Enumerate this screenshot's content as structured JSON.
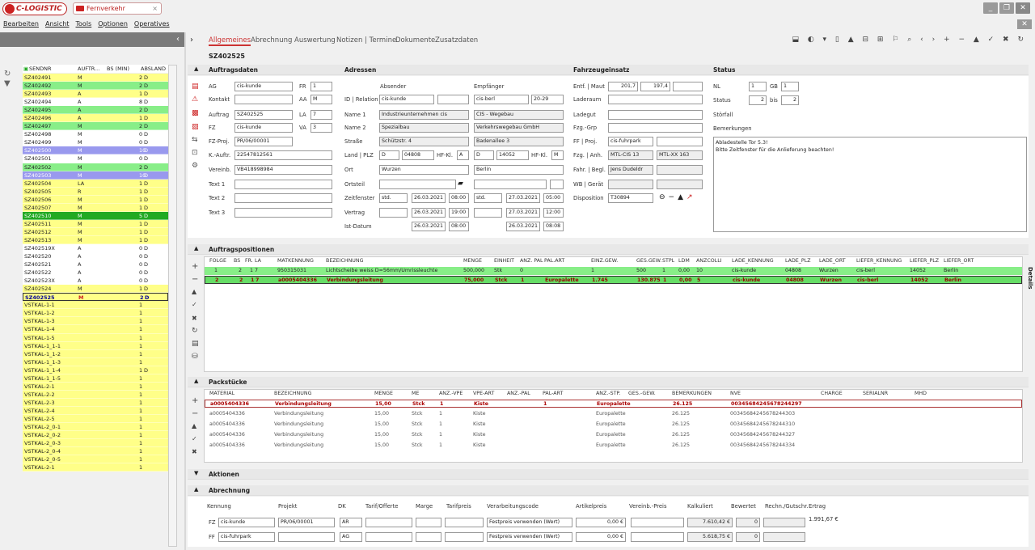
{
  "app": {
    "logo": "C-LOGISTIC",
    "tab": "Fernverkehr"
  },
  "menu": [
    "Bearbeiten",
    "Ansicht",
    "Tools",
    "Optionen",
    "Operatives"
  ],
  "list": {
    "headers": [
      "SENDNR",
      "AUFTR...",
      "BS (MIN)",
      "ABSLAND"
    ],
    "rows": [
      [
        "SZ402491",
        "M",
        "2",
        "D",
        "#ffff88"
      ],
      [
        "SZ402492",
        "M",
        "2",
        "D",
        "#88ee88"
      ],
      [
        "SZ402493",
        "A",
        "1",
        "D",
        "#ffff88"
      ],
      [
        "SZ402494",
        "A",
        "8",
        "D",
        "#ffffff"
      ],
      [
        "SZ402495",
        "A",
        "2",
        "D",
        "#88ee88"
      ],
      [
        "SZ402496",
        "A",
        "1",
        "D",
        "#ffff88"
      ],
      [
        "SZ402497",
        "M",
        "2",
        "D",
        "#88ee88"
      ],
      [
        "SZ402498",
        "M",
        "0",
        "D",
        "#ffffff"
      ],
      [
        "SZ402499",
        "M",
        "0",
        "D",
        "#ffffff"
      ],
      [
        "SZ402500",
        "M",
        "10",
        "D",
        "#9999ee"
      ],
      [
        "SZ402501",
        "M",
        "0",
        "D",
        "#ffffff"
      ],
      [
        "SZ402502",
        "M",
        "2",
        "D",
        "#88ee88"
      ],
      [
        "SZ402503",
        "M",
        "10",
        "D",
        "#9999ee"
      ],
      [
        "SZ402504",
        "LA",
        "1",
        "D",
        "#ffff88"
      ],
      [
        "SZ402505",
        "R",
        "1",
        "D",
        "#ffff88"
      ],
      [
        "SZ402506",
        "M",
        "1",
        "D",
        "#ffff88"
      ],
      [
        "SZ402507",
        "M",
        "1",
        "D",
        "#ffff88"
      ],
      [
        "SZ402510",
        "M",
        "5",
        "D",
        "#22aa22"
      ],
      [
        "SZ402511",
        "M",
        "1",
        "D",
        "#ffff88"
      ],
      [
        "SZ402512",
        "M",
        "1",
        "D",
        "#ffff88"
      ],
      [
        "SZ402513",
        "M",
        "1",
        "D",
        "#ffff88"
      ],
      [
        "SZ402519X",
        "A",
        "0",
        "D",
        "#ffffff"
      ],
      [
        "SZ402520",
        "A",
        "0",
        "D",
        "#ffffff"
      ],
      [
        "SZ402521",
        "A",
        "0",
        "D",
        "#ffffff"
      ],
      [
        "SZ402522",
        "A",
        "0",
        "D",
        "#ffffff"
      ],
      [
        "SZ402523X",
        "A",
        "0",
        "D",
        "#ffffff"
      ],
      [
        "SZ402524",
        "M",
        "1",
        "D",
        "#ffff88"
      ],
      [
        "SZ402525",
        "M",
        "2",
        "D",
        "#ffff88"
      ],
      [
        "VSTKAL-1-1",
        "",
        "1",
        "",
        "#ffff88"
      ],
      [
        "VSTKAL-1-2",
        "",
        "1",
        "",
        "#ffff88"
      ],
      [
        "VSTKAL-1-3",
        "",
        "1",
        "",
        "#ffff88"
      ],
      [
        "VSTKAL-1-4",
        "",
        "1",
        "",
        "#ffff88"
      ],
      [
        "VSTKAL-1-5",
        "",
        "1",
        "",
        "#ffff88"
      ],
      [
        "VSTKAL-1_1-1",
        "",
        "1",
        "",
        "#ffff88"
      ],
      [
        "VSTKAL-1_1-2",
        "",
        "1",
        "",
        "#ffff88"
      ],
      [
        "VSTKAL-1_1-3",
        "",
        "1",
        "",
        "#ffff88"
      ],
      [
        "VSTKAL-1_1-4",
        "",
        "1",
        "D",
        "#ffff88"
      ],
      [
        "VSTKAL-1_1-5",
        "",
        "1",
        "",
        "#ffff88"
      ],
      [
        "VSTKAL-2-1",
        "",
        "1",
        "",
        "#ffff88"
      ],
      [
        "VSTKAL-2-2",
        "",
        "1",
        "",
        "#ffff88"
      ],
      [
        "VSTKAL-2-3",
        "",
        "1",
        "",
        "#ffff88"
      ],
      [
        "VSTKAL-2-4",
        "",
        "1",
        "",
        "#ffff88"
      ],
      [
        "VSTKAL-2-5",
        "",
        "1",
        "",
        "#ffff88"
      ],
      [
        "VSTKAL-2_0-1",
        "",
        "1",
        "",
        "#ffff88"
      ],
      [
        "VSTKAL-2_0-2",
        "",
        "1",
        "",
        "#ffff88"
      ],
      [
        "VSTKAL-2_0-3",
        "",
        "1",
        "",
        "#ffff88"
      ],
      [
        "VSTKAL-2_0-4",
        "",
        "1",
        "",
        "#ffff88"
      ],
      [
        "VSTKAL-2_0-5",
        "",
        "1",
        "",
        "#ffff88"
      ],
      [
        "VSTKAL-2-1",
        "",
        "1",
        "",
        "#ffff88"
      ]
    ]
  },
  "tabs": [
    "Allgemeines",
    "Abrechnung",
    "Auswertung",
    "Notizen | Termine",
    "Dokumente",
    "Zusatzdaten"
  ],
  "sendnr": "SZ402525",
  "sections": {
    "auftragsdaten": "Auftragsdaten",
    "adressen": "Adressen",
    "fahrzeug": "Fahrzeugeinsatz",
    "status": "Status",
    "positionen": "Auftragspositionen",
    "pack": "Packstücke",
    "aktionen": "Aktionen",
    "abrechnung": "Abrechnung"
  },
  "auftrag": {
    "ag_label": "AG",
    "ag": "cis-kunde",
    "fr_label": "FR",
    "fr": "1",
    "kontakt_label": "Kontakt",
    "aa_label": "AA",
    "aa": "M",
    "auftrag_label": "Auftrag",
    "auftrag": "SZ402525",
    "la_label": "LA",
    "la": "7",
    "fz_label": "FZ",
    "fz": "cis-kunde",
    "va_label": "VA",
    "va": "3",
    "fzproj_label": "FZ-Proj.",
    "fzproj": "PR/06/00001",
    "kauftr_label": "K.-Auftr.",
    "kauftr": "22547812561",
    "vereinb_label": "Vereinb.",
    "vereinb": "VB418998984",
    "text1_label": "Text 1",
    "text2_label": "Text 2",
    "text3_label": "Text 3"
  },
  "adressen": {
    "absender_label": "Absender",
    "empf_label": "Empfänger",
    "id_label": "ID | Relation",
    "abs_id": "cis-kunde",
    "emp_id": "cis-berl",
    "emp_rel": "20-29",
    "name1_label": "Name 1",
    "abs_name1": "Industrieunternehmen cis",
    "emp_name1": "CIS - Wegebau",
    "name2_label": "Name 2",
    "abs_name2": "Spezialbau",
    "emp_name2": "Verkehrswegebau GmbH",
    "strasse_label": "Straße",
    "abs_str": "Schützstr. 4",
    "emp_str": "Badenallee 3",
    "land_label": "Land | PLZ",
    "abs_land": "D",
    "abs_plz": "04808",
    "hfkl_label": "HF-Kl.",
    "abs_hfkl": "A",
    "emp_land": "D",
    "emp_plz": "14052",
    "emp_hfkl": "M",
    "ort_label": "Ort",
    "abs_ort": "Wurzen",
    "emp_ort": "Berlin",
    "ortsteil_label": "Ortsteil",
    "zeitfenster_label": "Zeitfenster",
    "abs_zf": "std.",
    "abs_zf_date": "26.03.2021",
    "abs_zf_time": "08:00",
    "emp_zf": "std.",
    "emp_zf_date": "27.03.2021",
    "emp_zf_time": "05:00",
    "vertrag_label": "Vertrag",
    "abs_v_date": "26.03.2021",
    "abs_v_time": "19:00",
    "emp_v_date": "27.03.2021",
    "emp_v_time": "12:00",
    "ist_label": "Ist-Datum",
    "abs_ist_date": "26.03.2021",
    "abs_ist_time": "08:00",
    "emp_ist_date": "26.03.2021",
    "emp_ist_time": "08:08"
  },
  "fahrzeug": {
    "entf_label": "Entf. | Maut",
    "entf": "201,7",
    "maut": "197,4",
    "laderaum_label": "Laderaum",
    "ladegut_label": "Ladegut",
    "fzggrp_label": "Fzg.-Grp",
    "ffproj_label": "FF | Proj.",
    "ff": "cis-fuhrpark",
    "anh_label": "Fzg. | Anh.",
    "fzg": "MTL-CIS 13",
    "anh": "MTL-XX 163",
    "fahr_label": "Fahr. | Begl.",
    "fahrer": "Jens Dudeldr",
    "wb_label": "WB | Gerät",
    "dispo_label": "Disposition",
    "dispo": "T30894"
  },
  "status": {
    "nl_label": "NL",
    "nl": "1",
    "gb_label": "GB",
    "gb": "1",
    "status_label": "Status",
    "status_from": "2",
    "bis_label": "bis",
    "status_to": "2",
    "stoerfall_label": "Störfall",
    "bem_label": "Bemerkungen",
    "bem_line1": "Abladestelle Tor 5.3!",
    "bem_line2": "Bitte Zeitfenster für die Anlieferung beachten!"
  },
  "positionen": {
    "headers": [
      "FOLGE",
      "BS",
      "FR.",
      "LA",
      "MATKENNUNG",
      "BEZEICHNUNG",
      "MENGE",
      "EINHEIT",
      "ANZ. PAL",
      "PAL.ART",
      "EINZ.GEW.",
      "GES.GEW.",
      "STPL",
      "LDM",
      "ANZCOLLI",
      "LADE_KENNUNG",
      "LADE_PLZ",
      "LADE_ORT",
      "LIEFER_KENNUNG",
      "LIEFER_PLZ",
      "LIEFER_ORT"
    ],
    "rows": [
      [
        "1",
        "2",
        "1",
        "7",
        "950315031",
        "Lichtscheibe weiss D=56mm/Umrissleuchte",
        "500,000",
        "Stk",
        "0",
        "",
        "1",
        "500",
        "1",
        "0,00",
        "10",
        "cis-kunde",
        "04808",
        "Wurzen",
        "cis-berl",
        "14052",
        "Berlin"
      ],
      [
        "2",
        "2",
        "1",
        "7",
        "a0005404336",
        "Verbindungsleitung",
        "75,000",
        "Stck",
        "1",
        "Europalette",
        "1.745",
        "130.875",
        "1",
        "0,00",
        "5",
        "cis-kunde",
        "04808",
        "Wurzen",
        "cis-berl",
        "14052",
        "Berlin"
      ]
    ],
    "details_label": "Details"
  },
  "pack": {
    "headers": [
      "MATERIAL",
      "BEZEICHNUNG",
      "MENGE",
      "ME",
      "ANZ.-VPE",
      "VPE-ART",
      "ANZ.-PAL",
      "PAL-ART",
      "ANZ.-STP.",
      "GES.-GEW.",
      "BEMERKUNGEN",
      "NVE",
      "CHARGE",
      "SERIALNR",
      "MHD"
    ],
    "rows": [
      [
        "a0005404336",
        "Verbindungsleitung",
        "15,00",
        "Stck",
        "1",
        "Kiste",
        "",
        "1",
        "Europalette",
        "",
        "26.125",
        "",
        "00345684245678244297"
      ],
      [
        "a0005404336",
        "Verbindungsleitung",
        "15,00",
        "Stck",
        "1",
        "Kiste",
        "",
        "",
        "Europalette",
        "",
        "26.125",
        "",
        "00345684245678244303"
      ],
      [
        "a0005404336",
        "Verbindungsleitung",
        "15,00",
        "Stck",
        "1",
        "Kiste",
        "",
        "",
        "Europalette",
        "",
        "26.125",
        "",
        "00345684245678244310"
      ],
      [
        "a0005404336",
        "Verbindungsleitung",
        "15,00",
        "Stck",
        "1",
        "Kiste",
        "",
        "",
        "Europalette",
        "",
        "26.125",
        "",
        "00345684245678244327"
      ],
      [
        "a0005404336",
        "Verbindungsleitung",
        "15,00",
        "Stck",
        "1",
        "Kiste",
        "",
        "",
        "Europalette",
        "",
        "26.125",
        "",
        "00345684245678244334"
      ]
    ]
  },
  "abrechnung": {
    "headers": [
      "Kennung",
      "Projekt",
      "DK",
      "Tarif/Offerte",
      "Marge",
      "Tarifpreis",
      "Verarbeitungscode",
      "Artikelpreis",
      "Vereinb.-Preis",
      "Kalkuliert",
      "Bewertet",
      "Rechn./Gutschr.",
      "Ertrag"
    ],
    "fz_label": "FZ",
    "fz_kennung": "cis-kunde",
    "fz_projekt": "PR/06/00001",
    "fz_dk": "AR",
    "fz_code": "Festpreis verwenden (Wert)",
    "fz_artikel": "0,00 €",
    "fz_kalk": "7.610,42 €",
    "fz_bew": "0",
    "ertrag": "1.991,67 €",
    "ff_label": "FF",
    "ff_kennung": "cis-fuhrpark",
    "ff_dk": "AG",
    "ff_code": "Festpreis verwenden (Wert)",
    "ff_artikel": "0,00 €",
    "ff_kalk": "5.618,75 €",
    "ff_bew": "0"
  }
}
